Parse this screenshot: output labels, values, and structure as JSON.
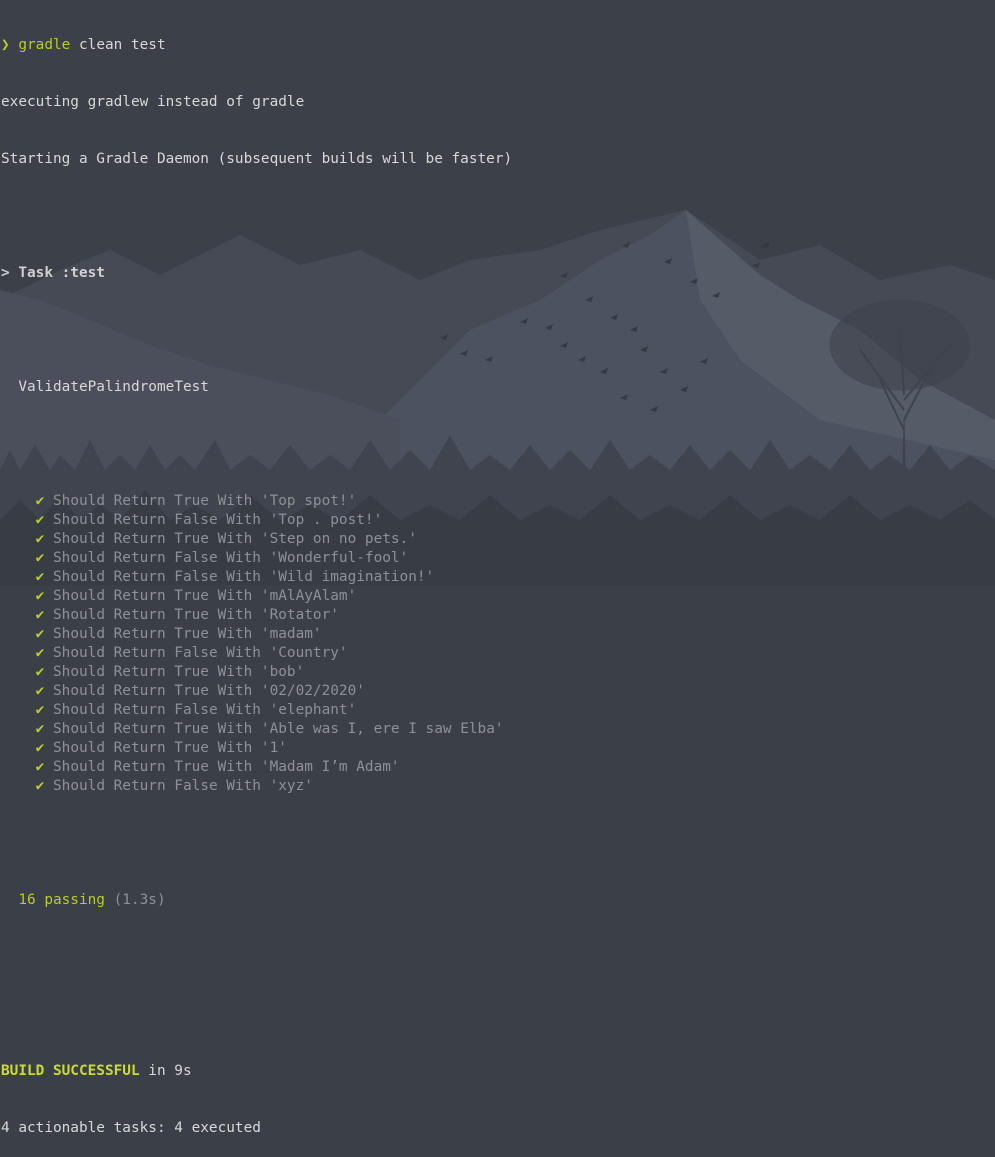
{
  "terminal": {
    "prompt": {
      "arrow": "❯",
      "command": "gradle",
      "args": " clean test"
    },
    "output_lines": [
      "executing gradlew instead of gradle",
      "Starting a Gradle Daemon (subsequent builds will be faster)"
    ],
    "task_header": "> Task :test",
    "suite_name": "ValidatePalindromeTest",
    "check_glyph": "✔",
    "tests": [
      "Should Return True With 'Top spot!'",
      "Should Return False With 'Top . post!'",
      "Should Return True With 'Step on no pets.'",
      "Should Return False With 'Wonderful-fool'",
      "Should Return False With 'Wild imagination!'",
      "Should Return True With 'mAlAyAlam'",
      "Should Return True With 'Rotator'",
      "Should Return True With 'madam'",
      "Should Return False With 'Country'",
      "Should Return True With 'bob'",
      "Should Return True With '02/02/2020'",
      "Should Return False With 'elephant'",
      "Should Return True With 'Able was I, ere I saw Elba'",
      "Should Return True With '1'",
      "Should Return True With 'Madam I’m Adam'",
      "Should Return False With 'xyz'"
    ],
    "summary": {
      "passing": "16 passing",
      "duration": "(1.3s)"
    },
    "build": {
      "status": "BUILD SUCCESSFUL",
      "time": " in 9s",
      "tasks": "4 actionable tasks: 4 executed"
    }
  },
  "colors": {
    "background": "#3b3f47",
    "accent_green": "#b8cc2b",
    "dim_text": "#8d9197",
    "text": "#d8d8d8"
  }
}
